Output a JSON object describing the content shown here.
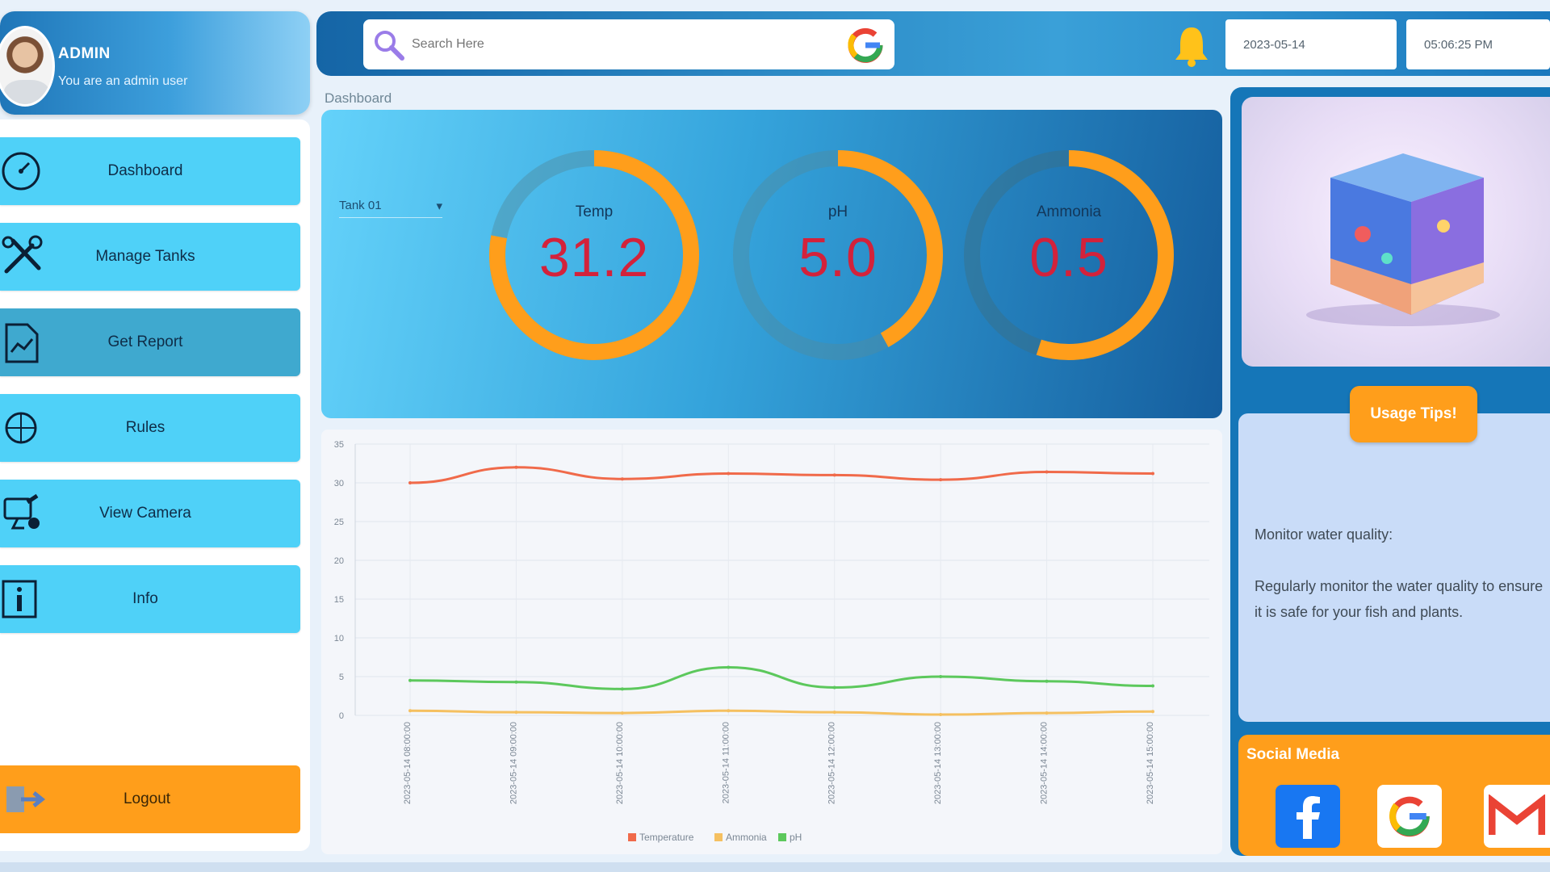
{
  "profile": {
    "name": "ADMIN",
    "role": "You are an admin user"
  },
  "nav": [
    {
      "label": "Dashboard",
      "icon": "dashboard-icon"
    },
    {
      "label": "Manage Tanks",
      "icon": "tools-icon"
    },
    {
      "label": "Get Report",
      "icon": "report-icon"
    },
    {
      "label": "Rules",
      "icon": "rules-icon"
    },
    {
      "label": "View Camera",
      "icon": "camera-icon"
    },
    {
      "label": "Info",
      "icon": "info-icon"
    }
  ],
  "logout": {
    "label": "Logout",
    "icon": "logout-icon"
  },
  "topbar": {
    "search_placeholder": "Search Here",
    "date": "2023-05-14",
    "time": "05:06:25 PM"
  },
  "breadcrumb": "Dashboard",
  "tank_select": {
    "value": "Tank 01"
  },
  "gauges": [
    {
      "label": "Temp",
      "value": "31.2",
      "fraction": 0.78
    },
    {
      "label": "pH",
      "value": "5.0",
      "fraction": 0.42
    },
    {
      "label": "Ammonia",
      "value": "0.5",
      "fraction": 0.55
    }
  ],
  "colors": {
    "accent": "#ff9e1b",
    "nav": "#4fd1f8",
    "gauge_value": "#d3223b",
    "temperature": "#f06a4a",
    "ammonia": "#f5c060",
    "ph": "#5cc85c"
  },
  "chart_data": {
    "type": "line",
    "x": [
      "2023-05-14 08:00:00",
      "2023-05-14 09:00:00",
      "2023-05-14 10:00:00",
      "2023-05-14 11:00:00",
      "2023-05-14 12:00:00",
      "2023-05-14 13:00:00",
      "2023-05-14 14:00:00",
      "2023-05-14 15:00:00"
    ],
    "ylim": [
      0,
      35
    ],
    "yticks": [
      0,
      5,
      10,
      15,
      20,
      25,
      30,
      35
    ],
    "series": [
      {
        "name": "Temperature",
        "color": "#f06a4a",
        "values": [
          30.0,
          32.0,
          30.5,
          31.2,
          31.0,
          30.4,
          31.4,
          31.2
        ]
      },
      {
        "name": "Ammonia",
        "color": "#f5c060",
        "values": [
          0.6,
          0.4,
          0.3,
          0.6,
          0.4,
          0.1,
          0.3,
          0.5
        ]
      },
      {
        "name": "pH",
        "color": "#5cc85c",
        "values": [
          4.5,
          4.3,
          3.4,
          6.2,
          3.6,
          5.0,
          4.4,
          3.8
        ]
      }
    ],
    "grid": true,
    "legend": "bottom"
  },
  "tips": {
    "button_label": "Usage Tips!",
    "title": "Monitor water quality:",
    "body": "Regularly monitor the water quality to ensure it is safe for your fish and plants."
  },
  "social": {
    "title": "Social Media",
    "items": [
      "facebook-icon",
      "google-icon",
      "gmail-icon"
    ]
  }
}
